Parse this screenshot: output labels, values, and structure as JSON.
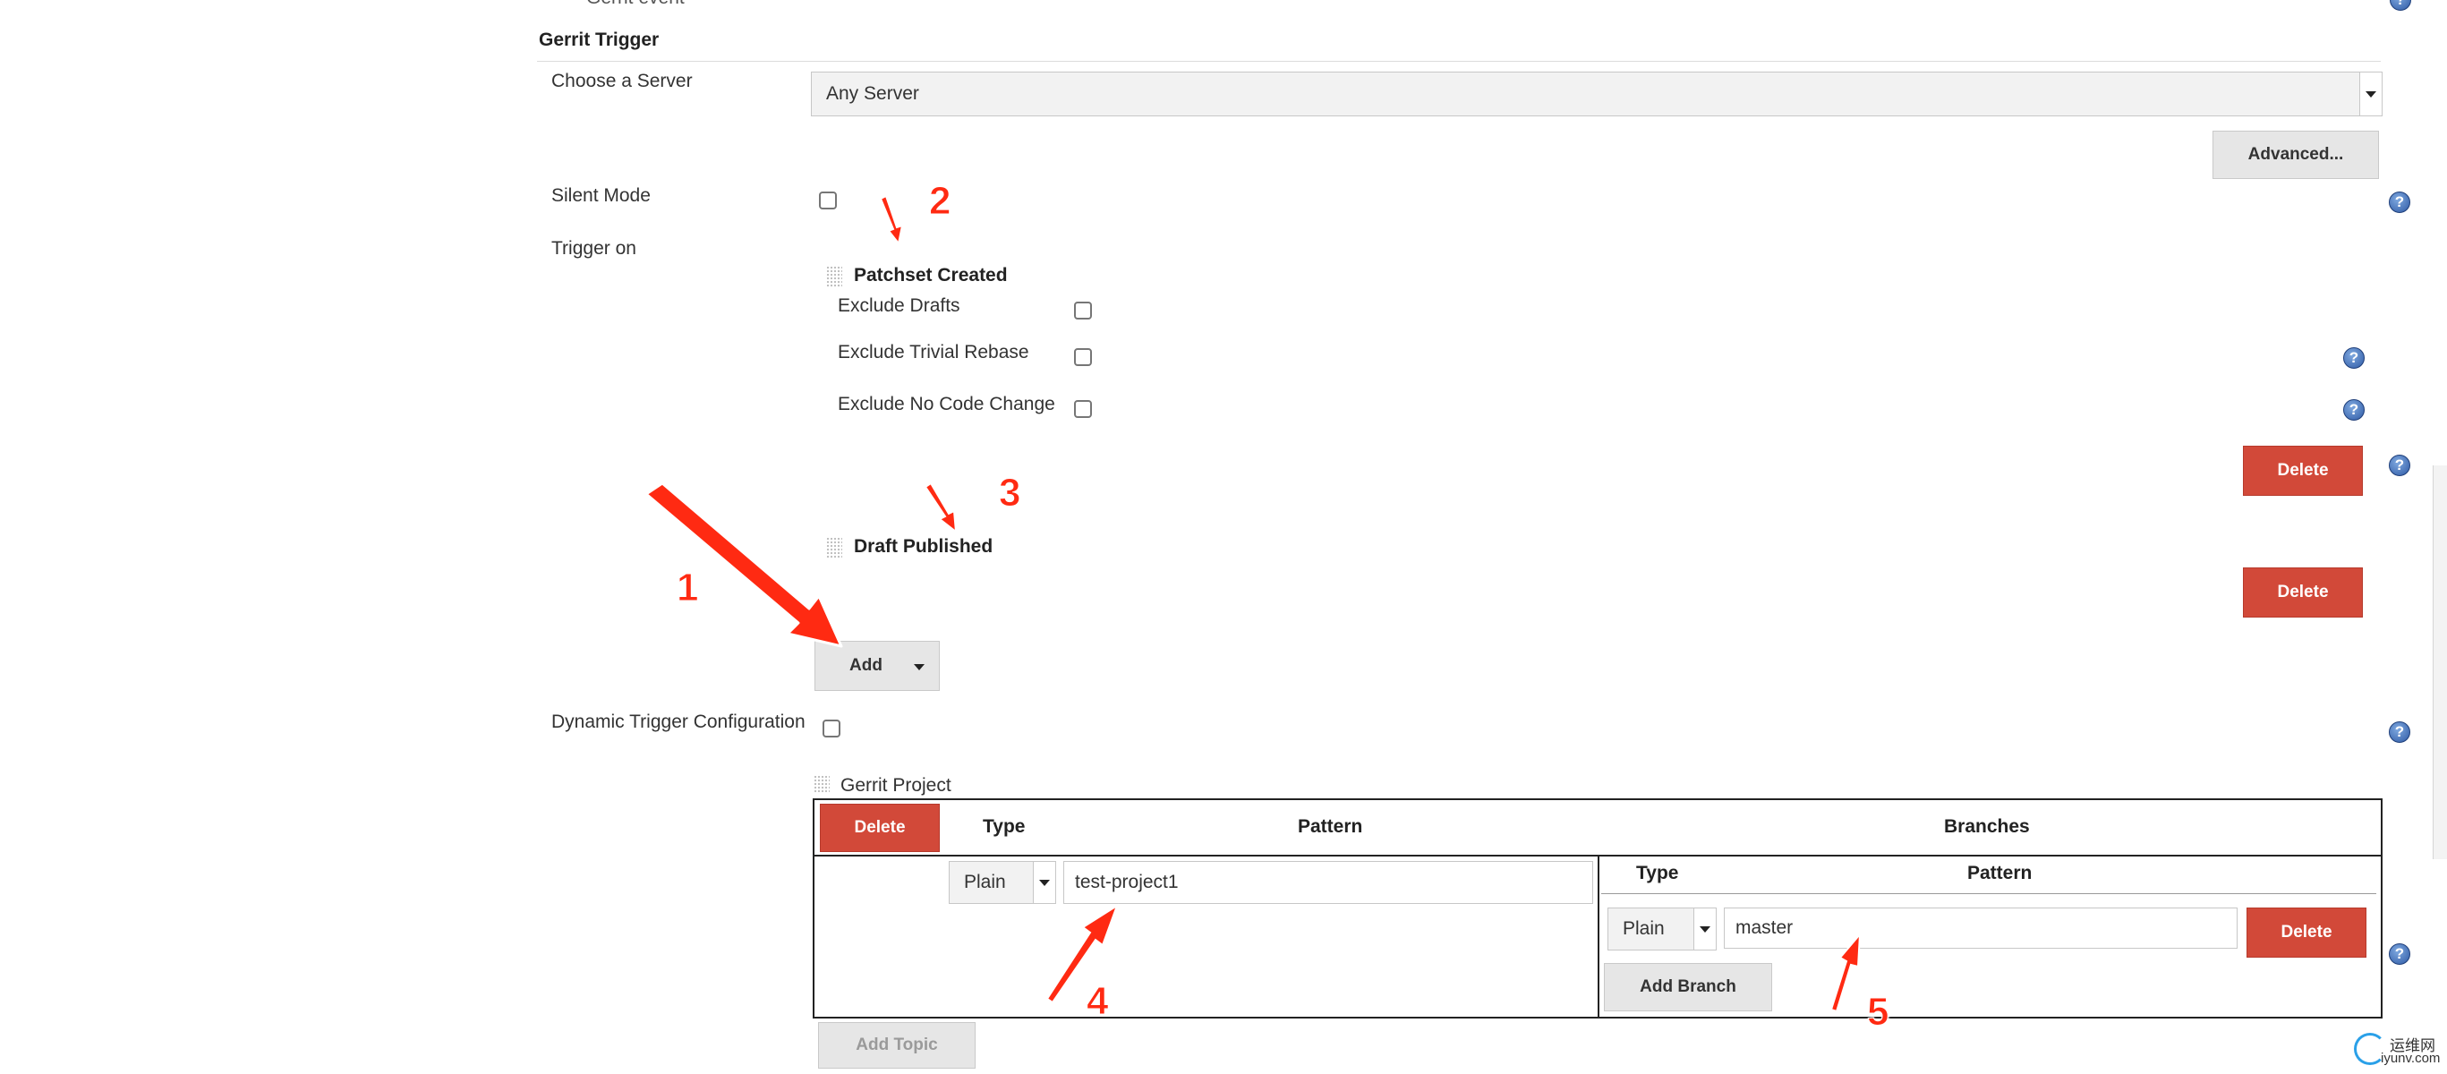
{
  "top_cut_text": "Gerrit event",
  "gerrit_trigger": {
    "title": "Gerrit Trigger",
    "choose_server": {
      "label": "Choose a Server",
      "value": "Any Server"
    },
    "advanced_button": "Advanced...",
    "silent_mode": {
      "label": "Silent Mode",
      "checked": false
    },
    "trigger_on_label": "Trigger on",
    "patchset_created": {
      "title": "Patchset Created",
      "options": [
        {
          "label": "Exclude Drafts",
          "checked": false
        },
        {
          "label": "Exclude Trivial Rebase",
          "checked": false
        },
        {
          "label": "Exclude No Code Change",
          "checked": false
        }
      ],
      "delete_button": "Delete"
    },
    "draft_published": {
      "title": "Draft Published",
      "delete_button": "Delete"
    },
    "add_button": "Add",
    "dynamic_trigger": {
      "label": "Dynamic Trigger Configuration",
      "checked": false
    },
    "gerrit_project": {
      "title": "Gerrit Project",
      "delete_button": "Delete",
      "headers": {
        "type": "Type",
        "pattern": "Pattern",
        "branches": "Branches"
      },
      "project_type": "Plain",
      "project_pattern": "test-project1",
      "branches": {
        "headers": {
          "type": "Type",
          "pattern": "Pattern"
        },
        "type": "Plain",
        "pattern": "master",
        "delete_button": "Delete",
        "add_branch_button": "Add Branch"
      },
      "add_topic_button": "Add Topic"
    }
  },
  "annotations": [
    "1",
    "2",
    "3",
    "4",
    "5"
  ],
  "watermark": {
    "line1": "运维网",
    "line2": "iyunv.com"
  },
  "colors": {
    "delete_red": "#d24939",
    "annotation_red": "#ff2a12",
    "help_blue": "#2f5aa5"
  }
}
